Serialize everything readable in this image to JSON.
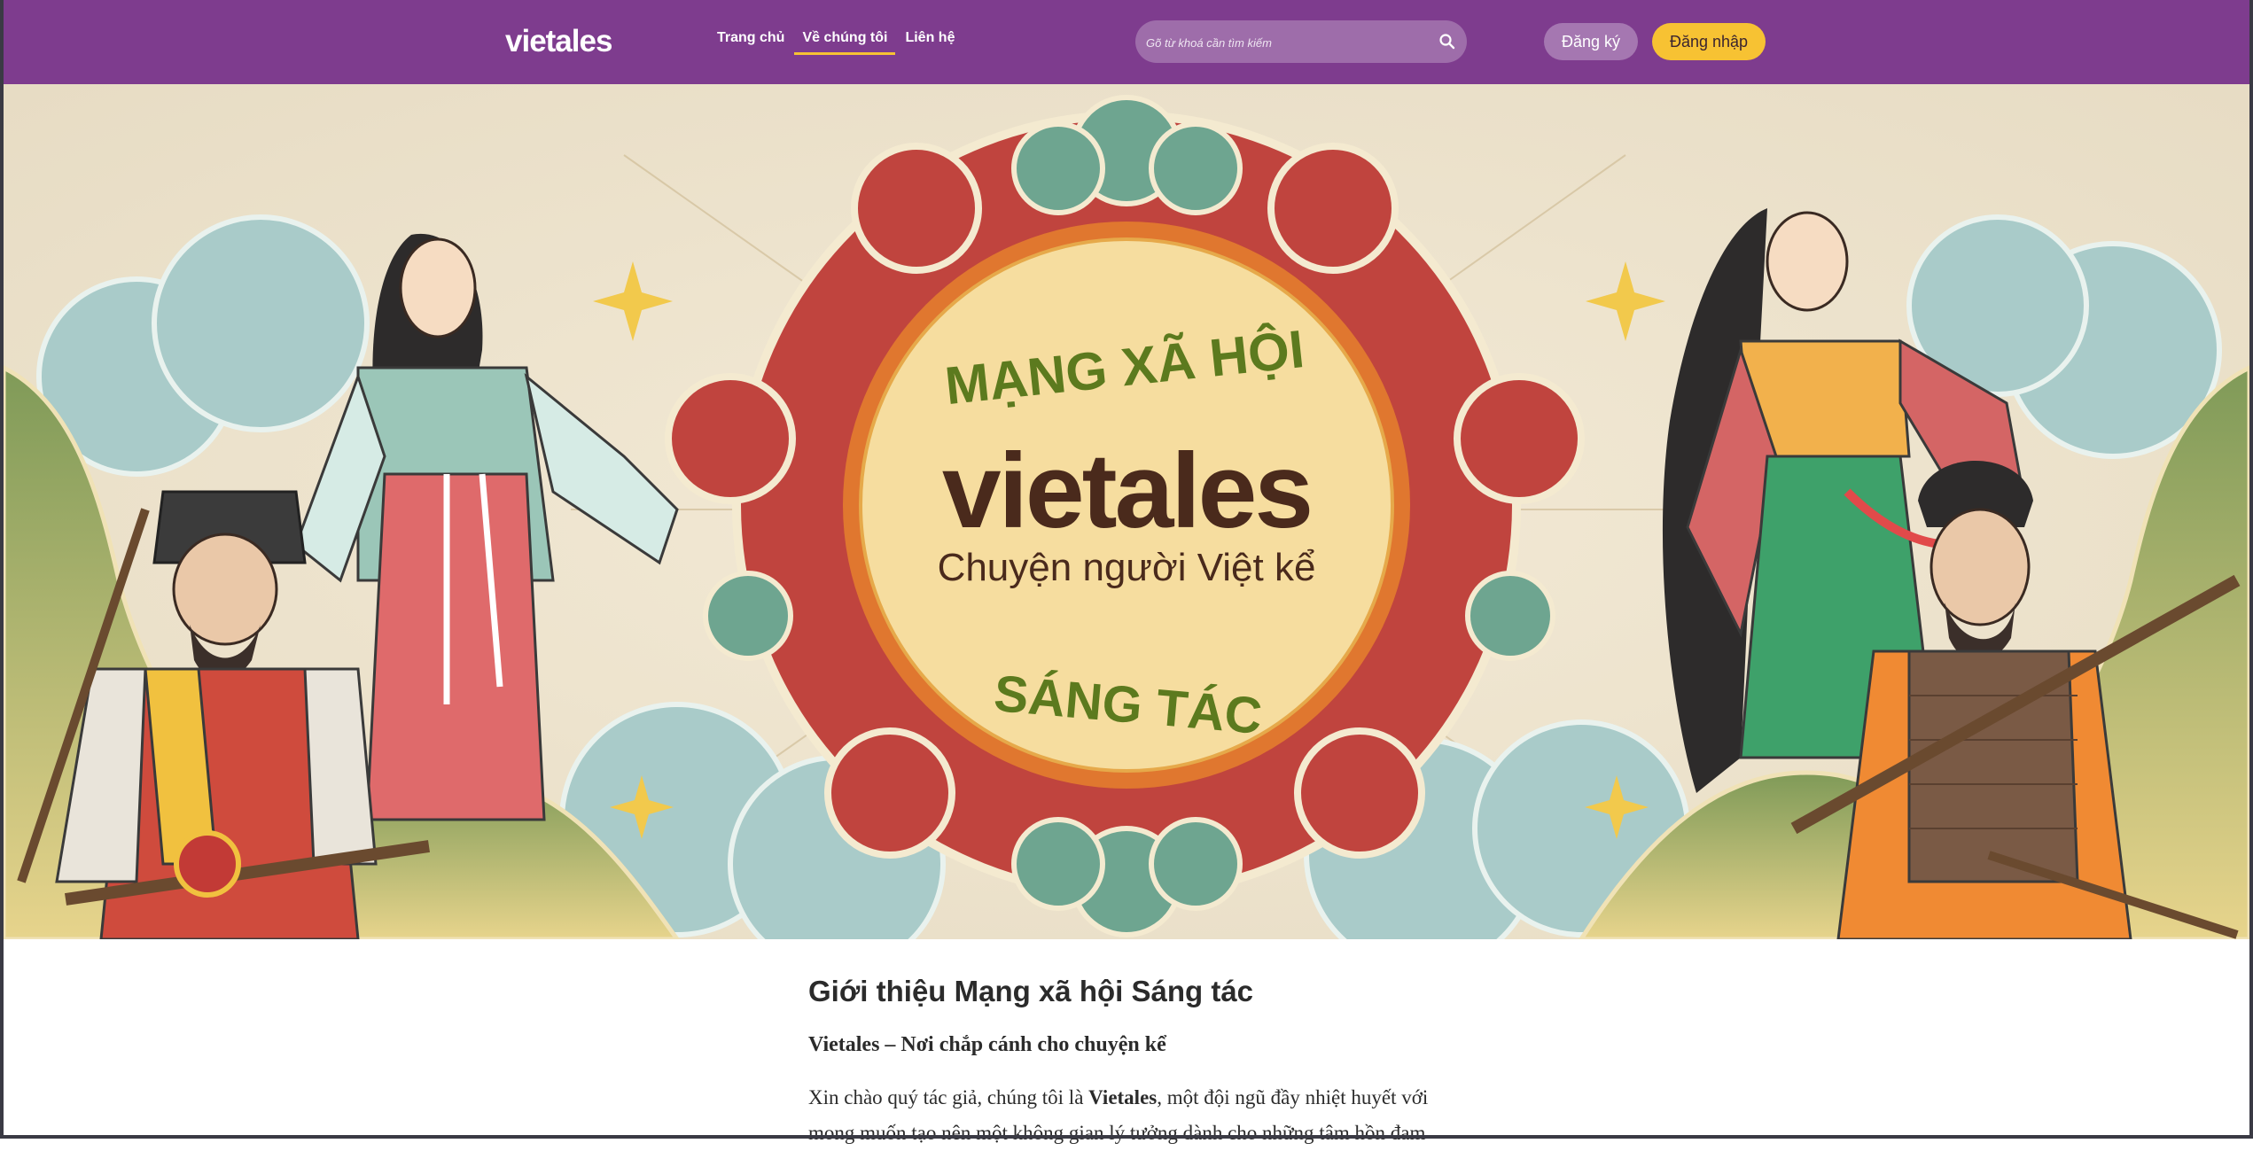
{
  "header": {
    "logo_text": "vietales",
    "nav": [
      {
        "label": "Trang chủ",
        "active": false
      },
      {
        "label": "Về chúng tôi",
        "active": true
      },
      {
        "label": "Liên hệ",
        "active": false
      }
    ],
    "search_placeholder": "Gõ từ khoá cần tìm kiếm",
    "register_label": "Đăng ký",
    "login_label": "Đăng nhập"
  },
  "banner": {
    "top_text": "MẠNG XÃ HỘI",
    "brand": "vietales",
    "tagline": "Chuyện người Việt kể",
    "bottom_text": "SÁNG TÁC"
  },
  "content": {
    "title": "Giới thiệu Mạng xã hội Sáng tác",
    "subtitle": "Vietales – Nơi chắp cánh cho chuyện kể",
    "intro_before": "Xin chào quý tác giả, chúng tôi là ",
    "intro_bold": "Vietales",
    "intro_after": ", một đội ngũ đầy nhiệt huyết với",
    "intro_line2": "mong muốn tạo nên một không gian lý tưởng dành cho những tâm hồn đam"
  },
  "colors": {
    "header_bg": "#7e3c8e",
    "accent_yellow": "#f7c233",
    "register_bg": "#a577b1",
    "medallion_red": "#c0443e",
    "medallion_orange": "#e0772f",
    "medallion_cream": "#f6dd9f",
    "banner_green_text": "#5c7a1e",
    "brand_dark": "#4a2a1c"
  }
}
